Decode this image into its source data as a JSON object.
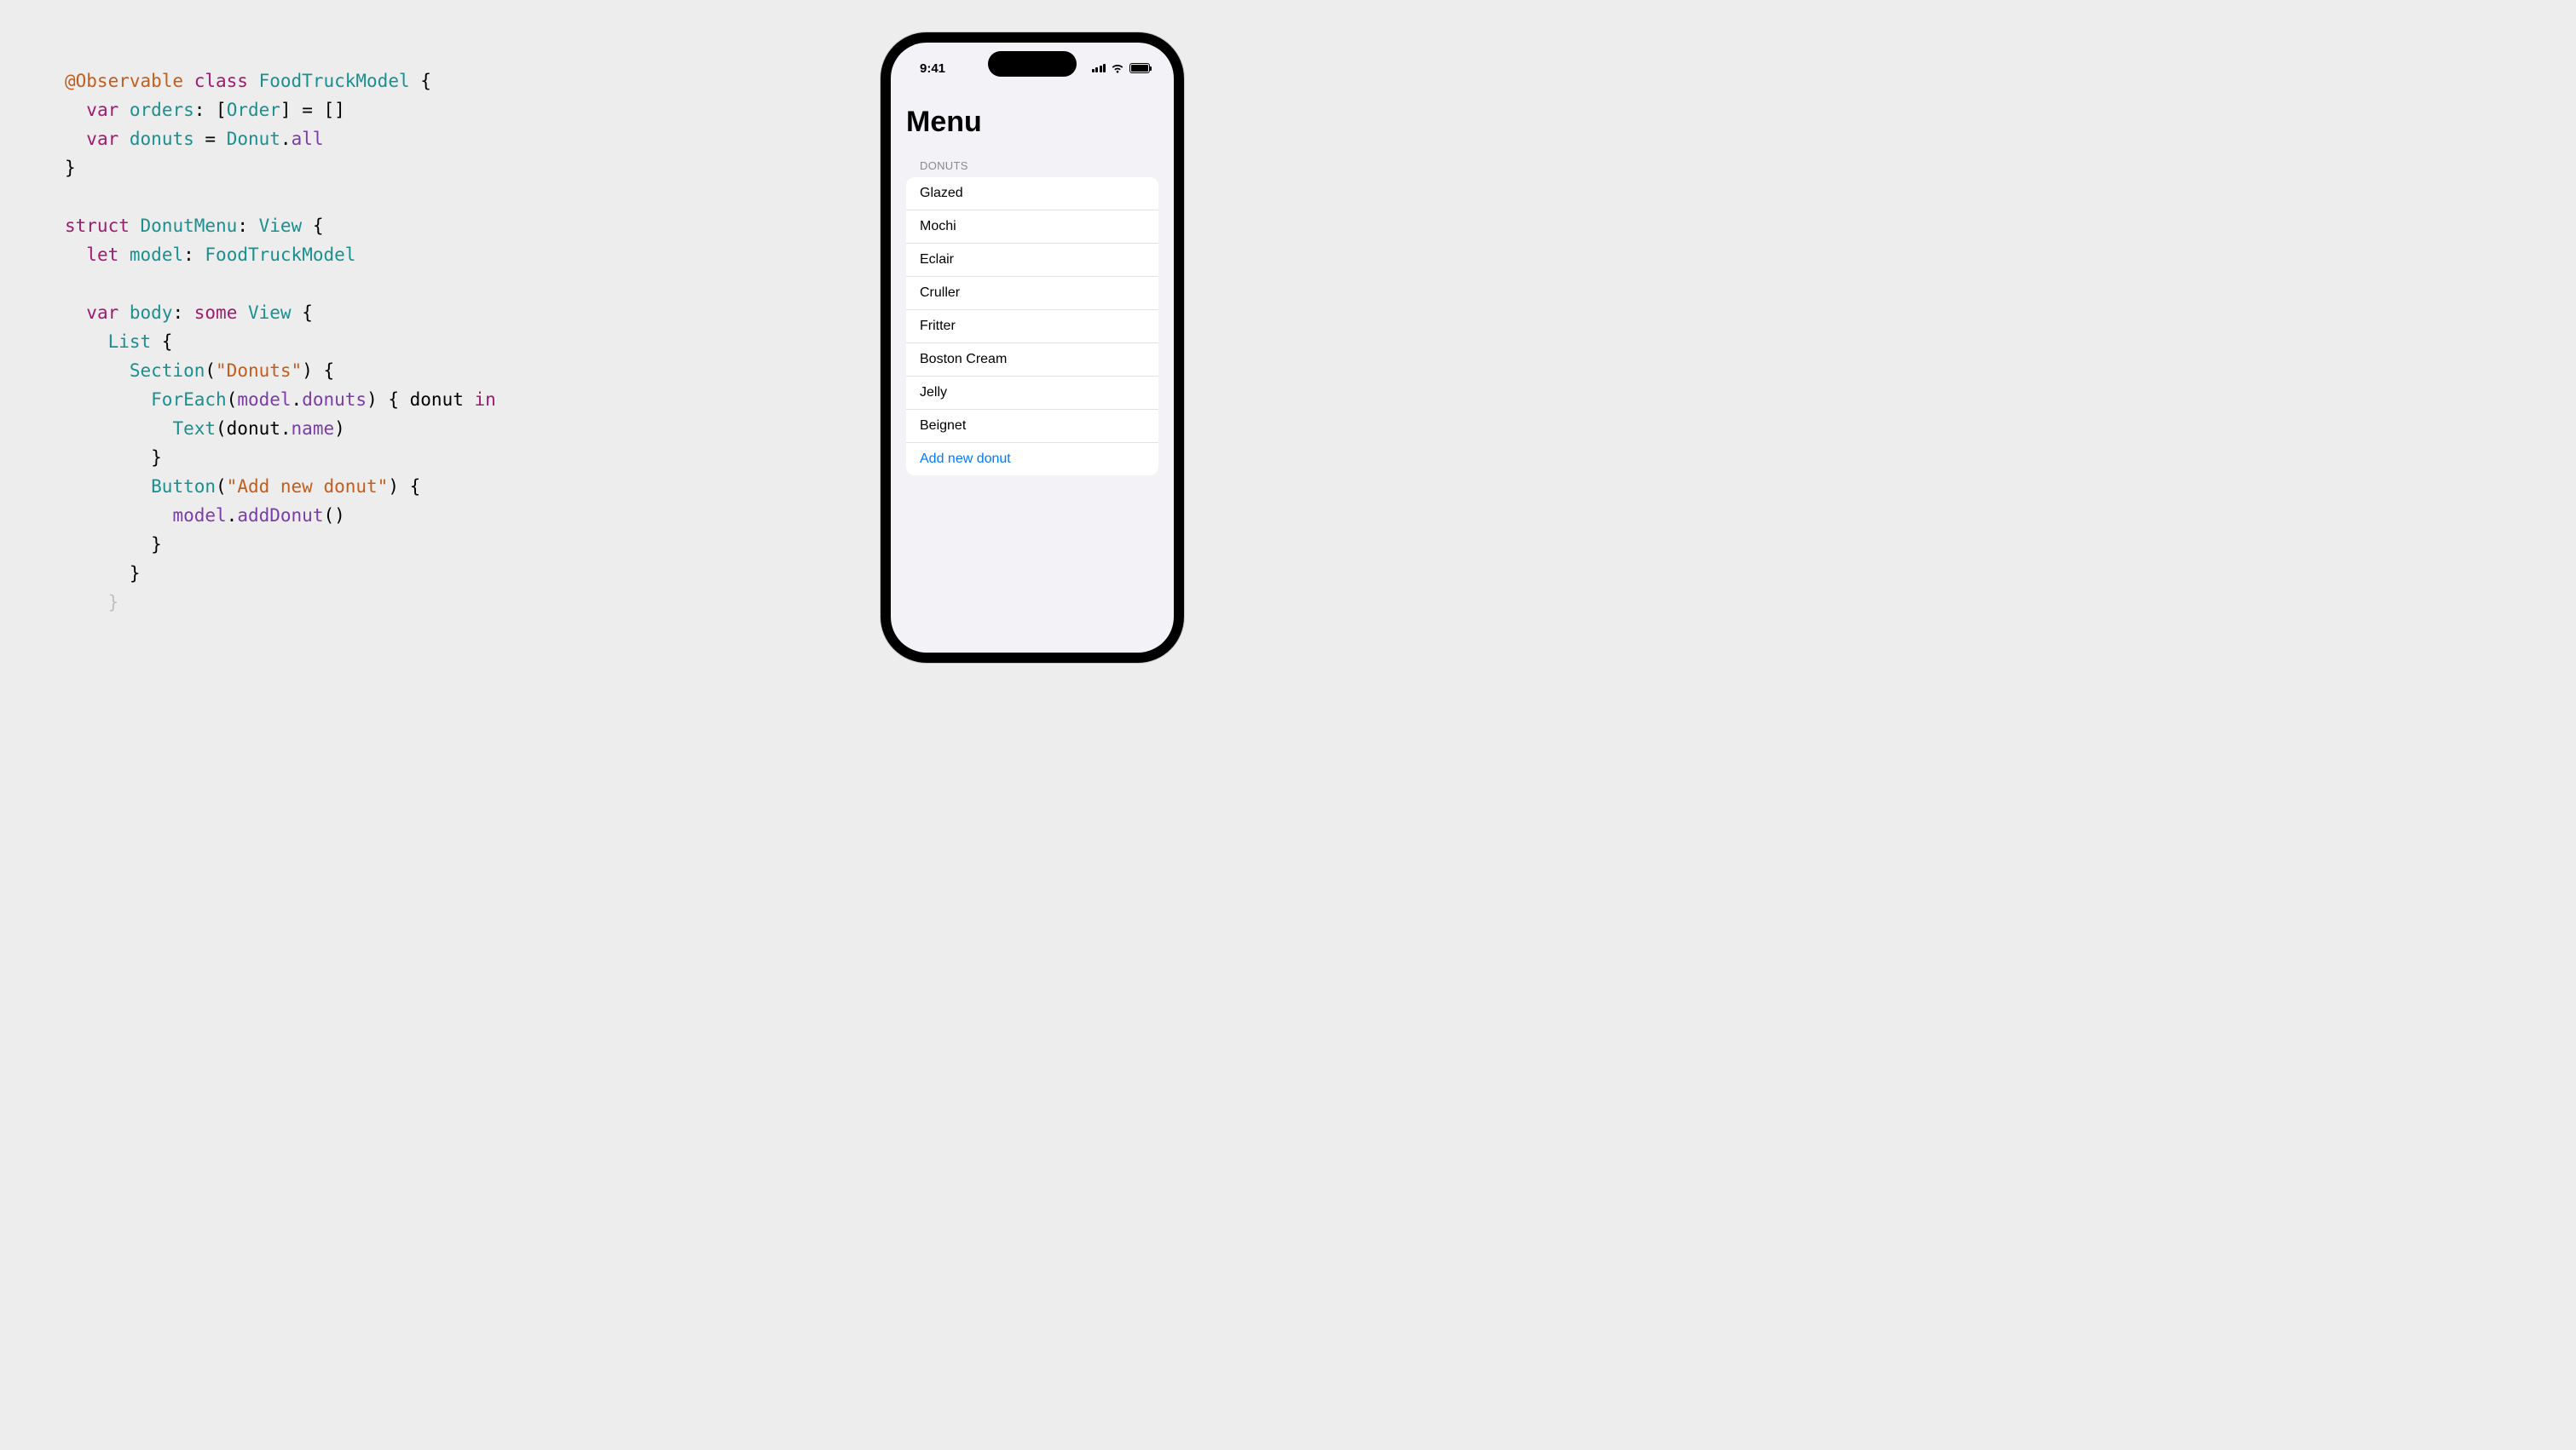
{
  "code": {
    "tokens": [
      [
        {
          "t": "@Observable",
          "c": "tok-orange"
        },
        {
          "t": " "
        },
        {
          "t": "class",
          "c": "tok-pink"
        },
        {
          "t": " "
        },
        {
          "t": "FoodTruckModel",
          "c": "tok-teal"
        },
        {
          "t": " {"
        }
      ],
      [
        {
          "t": "  "
        },
        {
          "t": "var",
          "c": "tok-pink"
        },
        {
          "t": " "
        },
        {
          "t": "orders",
          "c": "tok-teal"
        },
        {
          "t": ": ["
        },
        {
          "t": "Order",
          "c": "tok-teal"
        },
        {
          "t": "] = []"
        }
      ],
      [
        {
          "t": "  "
        },
        {
          "t": "var",
          "c": "tok-pink"
        },
        {
          "t": " "
        },
        {
          "t": "donuts",
          "c": "tok-teal"
        },
        {
          "t": " = "
        },
        {
          "t": "Donut",
          "c": "tok-teal"
        },
        {
          "t": "."
        },
        {
          "t": "all",
          "c": "tok-purple"
        }
      ],
      [
        {
          "t": "}"
        }
      ],
      [
        {
          "t": ""
        }
      ],
      [
        {
          "t": "struct",
          "c": "tok-pink"
        },
        {
          "t": " "
        },
        {
          "t": "DonutMenu",
          "c": "tok-teal"
        },
        {
          "t": ": "
        },
        {
          "t": "View",
          "c": "tok-teal"
        },
        {
          "t": " {"
        }
      ],
      [
        {
          "t": "  "
        },
        {
          "t": "let",
          "c": "tok-pink"
        },
        {
          "t": " "
        },
        {
          "t": "model",
          "c": "tok-teal"
        },
        {
          "t": ": "
        },
        {
          "t": "FoodTruckModel",
          "c": "tok-teal"
        }
      ],
      [
        {
          "t": ""
        }
      ],
      [
        {
          "t": "  "
        },
        {
          "t": "var",
          "c": "tok-pink"
        },
        {
          "t": " "
        },
        {
          "t": "body",
          "c": "tok-teal"
        },
        {
          "t": ": "
        },
        {
          "t": "some",
          "c": "tok-pink"
        },
        {
          "t": " "
        },
        {
          "t": "View",
          "c": "tok-teal"
        },
        {
          "t": " {"
        }
      ],
      [
        {
          "t": "    "
        },
        {
          "t": "List",
          "c": "tok-teal"
        },
        {
          "t": " {"
        }
      ],
      [
        {
          "t": "      "
        },
        {
          "t": "Section",
          "c": "tok-teal"
        },
        {
          "t": "("
        },
        {
          "t": "\"Donuts\"",
          "c": "tok-orange"
        },
        {
          "t": ") {"
        }
      ],
      [
        {
          "t": "        "
        },
        {
          "t": "ForEach",
          "c": "tok-teal"
        },
        {
          "t": "("
        },
        {
          "t": "model",
          "c": "tok-purple"
        },
        {
          "t": "."
        },
        {
          "t": "donuts",
          "c": "tok-purple"
        },
        {
          "t": ") { donut "
        },
        {
          "t": "in",
          "c": "tok-pink"
        }
      ],
      [
        {
          "t": "          "
        },
        {
          "t": "Text",
          "c": "tok-teal"
        },
        {
          "t": "(donut."
        },
        {
          "t": "name",
          "c": "tok-purple"
        },
        {
          "t": ")"
        }
      ],
      [
        {
          "t": "        }"
        }
      ],
      [
        {
          "t": "        "
        },
        {
          "t": "Button",
          "c": "tok-teal"
        },
        {
          "t": "("
        },
        {
          "t": "\"Add new donut\"",
          "c": "tok-orange"
        },
        {
          "t": ") {"
        }
      ],
      [
        {
          "t": "          "
        },
        {
          "t": "model",
          "c": "tok-purple"
        },
        {
          "t": "."
        },
        {
          "t": "addDonut",
          "c": "tok-purple"
        },
        {
          "t": "()"
        }
      ],
      [
        {
          "t": "        }"
        }
      ],
      [
        {
          "t": "      }"
        }
      ],
      [
        {
          "t": "    }",
          "c": "tok-faded"
        }
      ]
    ]
  },
  "phone": {
    "status_time": "9:41",
    "nav_title": "Menu",
    "section_header": "DONUTS",
    "donuts": [
      "Glazed",
      "Mochi",
      "Eclair",
      "Cruller",
      "Fritter",
      "Boston Cream",
      "Jelly",
      "Beignet"
    ],
    "add_button_label": "Add new donut"
  }
}
